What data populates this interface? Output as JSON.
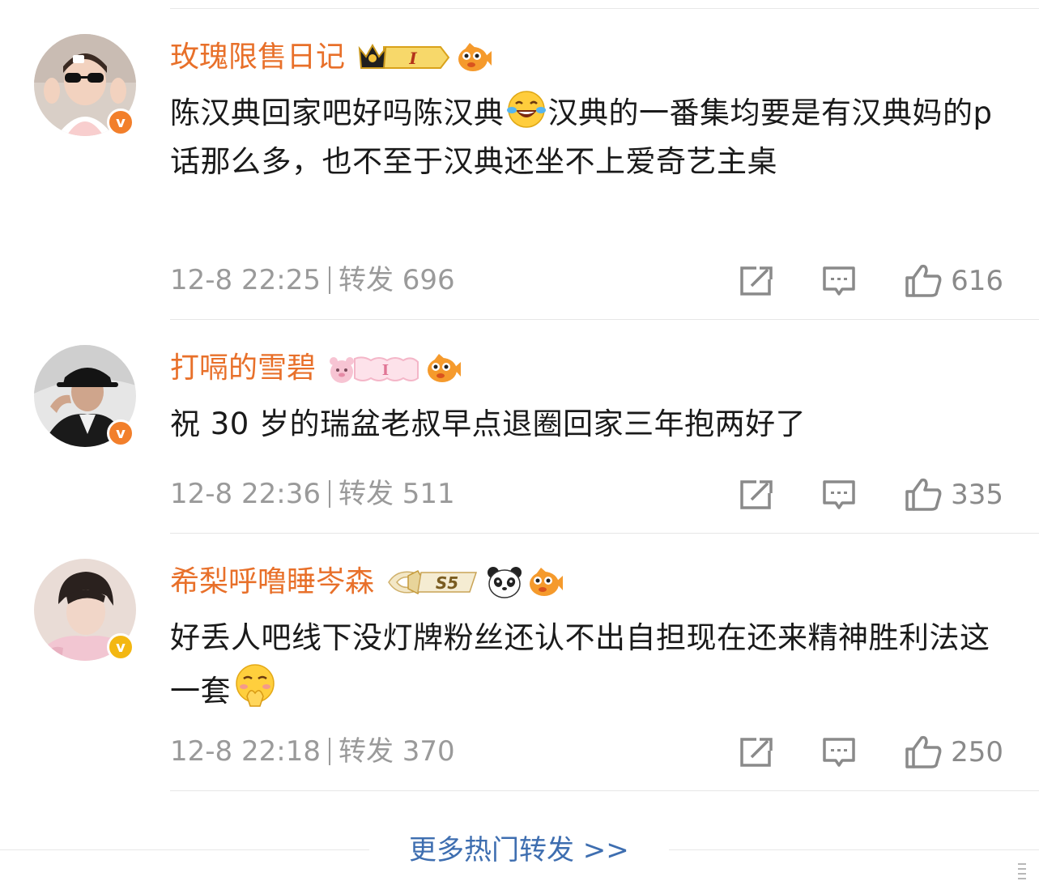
{
  "colors": {
    "username": "#e8702a",
    "meta": "#9a9a9a",
    "link": "#3e6eb0",
    "verified_orange": "#f27f2b",
    "verified_gold": "#f3b712"
  },
  "reposts": [
    {
      "username": "玫瑰限售日记",
      "badges": [
        "crown-level-badge",
        "fish-icon"
      ],
      "level_label": "I",
      "verified": "v",
      "text_parts": [
        "陈汉典回家吧好吗陈汉典",
        "汉典的一番集均要是有汉典妈的p话那么多，也不至于汉典还坐不上爱奇艺主桌"
      ],
      "emoji": "laughing-tears-emoji",
      "time": "12-8 22:25",
      "repost_label": "转发 696",
      "likes": "616"
    },
    {
      "username": "打嗝的雪碧",
      "badges": [
        "pink-bear-badge",
        "fish-icon"
      ],
      "level_label": "I",
      "verified": "v",
      "text_parts": [
        "祝 30 岁的瑞盆老叔早点退圈回家三年抱两好了"
      ],
      "time": "12-8 22:36",
      "repost_label": "转发 511",
      "likes": "335"
    },
    {
      "username": "希梨呼噜睡岑森",
      "badges": [
        "s5-wing-badge",
        "panda-icon",
        "fish-icon"
      ],
      "level_label": "S5",
      "verified": "v",
      "text_parts": [
        "好丢人吧线下没灯牌粉丝还认不出自担现在还来精神胜利法这一套"
      ],
      "emoji": "shy-pleading-emoji",
      "time": "12-8 22:18",
      "repost_label": "转发 370",
      "likes": "250"
    }
  ],
  "more_link": "更多热门转发 >>"
}
